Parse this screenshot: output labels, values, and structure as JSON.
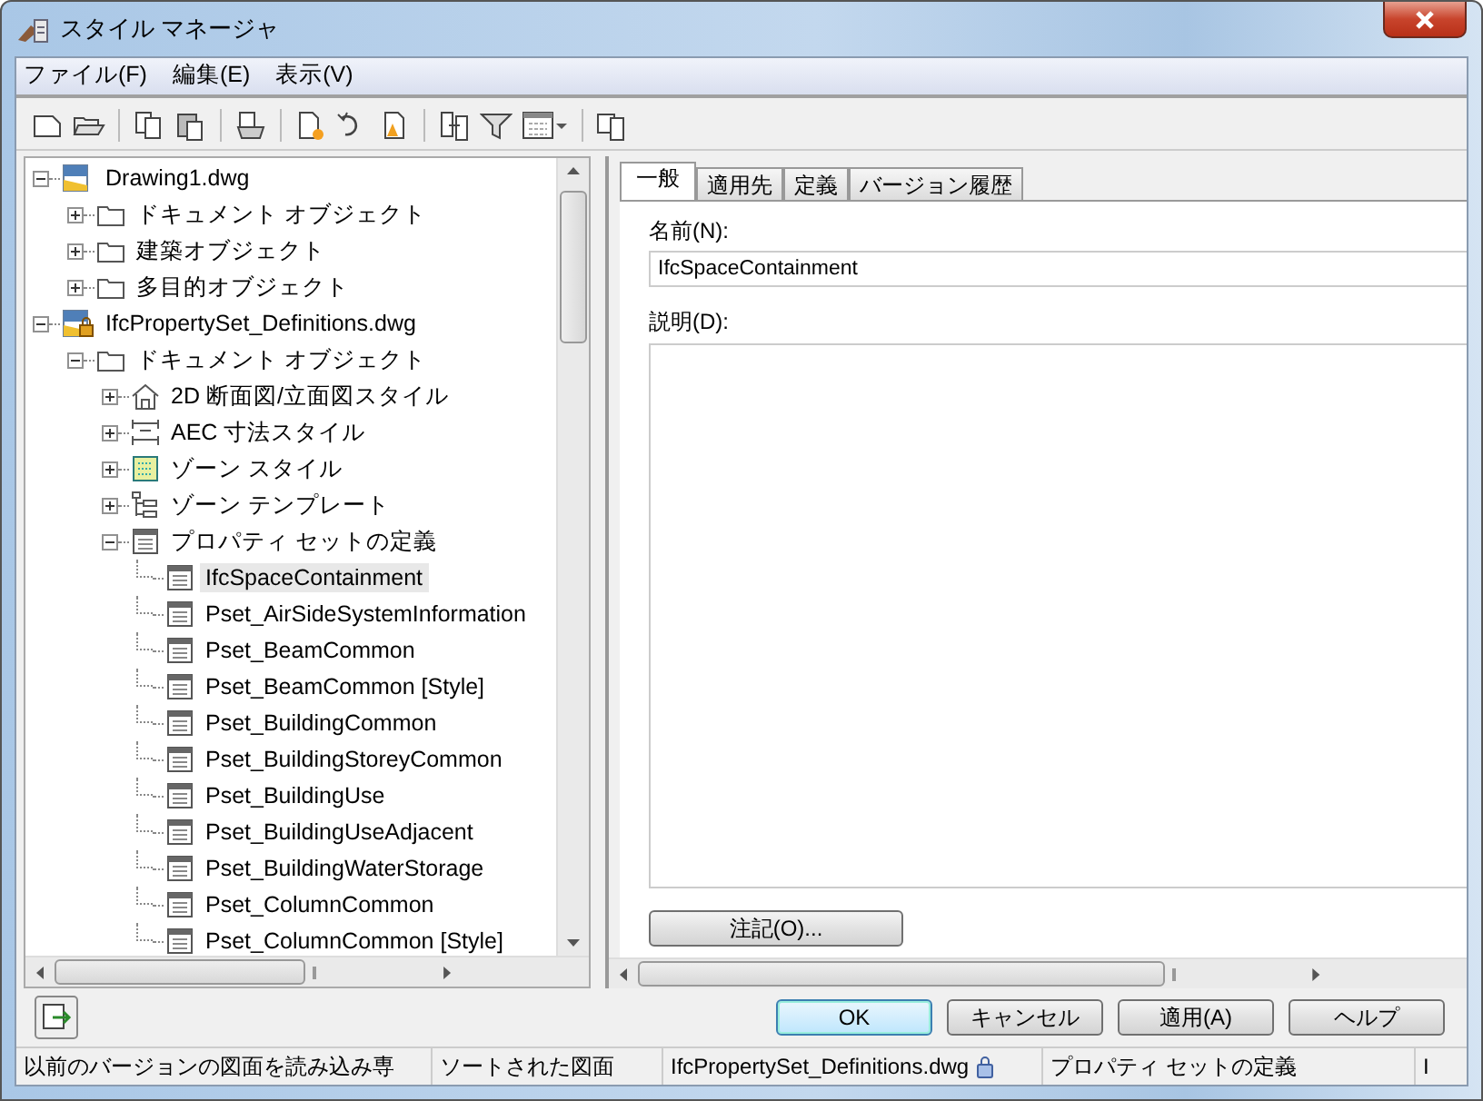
{
  "window": {
    "title": "スタイル マネージャ"
  },
  "menu": [
    "ファイル(F)",
    "編集(E)",
    "表示(V)"
  ],
  "toolbar": [
    {
      "kind": "new"
    },
    {
      "kind": "open"
    },
    {
      "kind": "sep"
    },
    {
      "kind": "copy"
    },
    {
      "kind": "paste"
    },
    {
      "kind": "sep"
    },
    {
      "kind": "purge"
    },
    {
      "kind": "sep"
    },
    {
      "kind": "newstyle"
    },
    {
      "kind": "convert"
    },
    {
      "kind": "edit"
    },
    {
      "kind": "sep"
    },
    {
      "kind": "compare"
    },
    {
      "kind": "filter"
    },
    {
      "kind": "view"
    },
    {
      "kind": "sep"
    },
    {
      "kind": "toggle"
    }
  ],
  "tree": [
    {
      "label": "Drawing1.dwg",
      "kind": "drawing",
      "expanded": true,
      "selected": false,
      "children": [
        {
          "label": "ドキュメント オブジェクト",
          "kind": "folder",
          "expanded": false,
          "selected": false
        },
        {
          "label": "建築オブジェクト",
          "kind": "folder",
          "expanded": false,
          "selected": false
        },
        {
          "label": "多目的オブジェクト",
          "kind": "folder",
          "expanded": false,
          "selected": false
        }
      ]
    },
    {
      "label": "IfcPropertySet_Definitions.dwg",
      "kind": "locked-drawing",
      "expanded": true,
      "selected": false,
      "children": [
        {
          "label": "ドキュメント オブジェクト",
          "kind": "folder",
          "expanded": true,
          "selected": false,
          "children": [
            {
              "label": "2D 断面図/立面図スタイル",
              "kind": "elevation",
              "expanded": false,
              "selected": false
            },
            {
              "label": "AEC 寸法スタイル",
              "kind": "dimension",
              "expanded": false,
              "selected": false
            },
            {
              "label": "ゾーン スタイル",
              "kind": "zone",
              "expanded": false,
              "selected": false
            },
            {
              "label": "ゾーン テンプレート",
              "kind": "template",
              "expanded": false,
              "selected": false
            },
            {
              "label": "プロパティ セットの定義",
              "kind": "propset",
              "expanded": true,
              "selected": false,
              "children": [
                {
                  "label": "IfcSpaceContainment",
                  "kind": "propset",
                  "selected": true
                },
                {
                  "label": "Pset_AirSideSystemInformation",
                  "kind": "propset",
                  "selected": false
                },
                {
                  "label": "Pset_BeamCommon",
                  "kind": "propset",
                  "selected": false
                },
                {
                  "label": "Pset_BeamCommon [Style]",
                  "kind": "propset",
                  "selected": false
                },
                {
                  "label": "Pset_BuildingCommon",
                  "kind": "propset",
                  "selected": false
                },
                {
                  "label": "Pset_BuildingStoreyCommon",
                  "kind": "propset",
                  "selected": false
                },
                {
                  "label": "Pset_BuildingUse",
                  "kind": "propset",
                  "selected": false
                },
                {
                  "label": "Pset_BuildingUseAdjacent",
                  "kind": "propset",
                  "selected": false
                },
                {
                  "label": "Pset_BuildingWaterStorage",
                  "kind": "propset",
                  "selected": false
                },
                {
                  "label": "Pset_ColumnCommon",
                  "kind": "propset",
                  "selected": false
                },
                {
                  "label": "Pset_ColumnCommon [Style]",
                  "kind": "propset",
                  "selected": false
                }
              ]
            }
          ]
        }
      ]
    }
  ],
  "tabs": [
    {
      "label": "一般",
      "selected": true
    },
    {
      "label": "適用先",
      "selected": false
    },
    {
      "label": "定義",
      "selected": false
    },
    {
      "label": "バージョン履歴",
      "selected": false
    }
  ],
  "name_label": "名前(N):",
  "name_value": "IfcSpaceContainment",
  "description_label": "説明(D):",
  "notes_button": "注記(O)...",
  "buttons": [
    {
      "label": "OK",
      "default": true
    },
    {
      "label": "キャンセル",
      "default": false
    },
    {
      "label": "適用(A)",
      "default": false
    },
    {
      "label": "ヘルプ",
      "default": false
    }
  ],
  "status_bar": [
    {
      "text": "以前のバージョンの図面を読み込み専"
    },
    {
      "text": "ソートされた図面"
    },
    {
      "text": "IfcPropertySet_Definitions.dwg",
      "locked": true
    },
    {
      "text": "プロパティ セットの定義"
    },
    {
      "text": "I"
    }
  ]
}
